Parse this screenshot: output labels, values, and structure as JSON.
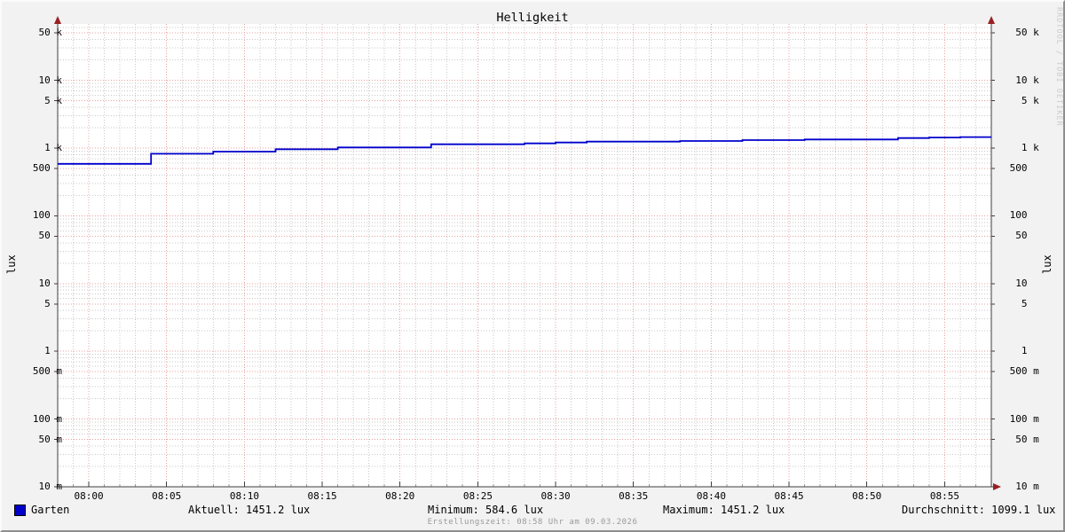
{
  "title": "Helligkeit",
  "watermark": "RRDTOOL / TOBI OETIKER",
  "footer": "Erstellungszeit: 08:58 Uhr am 09.03.2026",
  "axis": {
    "y_label_left": "lux",
    "y_label_right": "lux",
    "y_ticks": [
      {
        "value": 50000,
        "label": "  50 k"
      },
      {
        "value": 10000,
        "label": "  10 k"
      },
      {
        "value": 5000,
        "label": "   5 k"
      },
      {
        "value": 1000,
        "label": "   1 k"
      },
      {
        "value": 500,
        "label": " 500  "
      },
      {
        "value": 100,
        "label": " 100  "
      },
      {
        "value": 50,
        "label": "  50  "
      },
      {
        "value": 10,
        "label": "  10  "
      },
      {
        "value": 5,
        "label": "   5  "
      },
      {
        "value": 1,
        "label": "   1  "
      },
      {
        "value": 0.5,
        "label": " 500 m"
      },
      {
        "value": 0.1,
        "label": " 100 m"
      },
      {
        "value": 0.05,
        "label": "  50 m"
      },
      {
        "value": 0.01,
        "label": "  10 m"
      }
    ],
    "x_ticks": [
      {
        "minute": 2,
        "label": "08:00"
      },
      {
        "minute": 7,
        "label": "08:05"
      },
      {
        "minute": 12,
        "label": "08:10"
      },
      {
        "minute": 17,
        "label": "08:15"
      },
      {
        "minute": 22,
        "label": "08:20"
      },
      {
        "minute": 27,
        "label": "08:25"
      },
      {
        "minute": 32,
        "label": "08:30"
      },
      {
        "minute": 37,
        "label": "08:35"
      },
      {
        "minute": 42,
        "label": "08:40"
      },
      {
        "minute": 47,
        "label": "08:45"
      },
      {
        "minute": 52,
        "label": "08:50"
      },
      {
        "minute": 57,
        "label": "08:55"
      }
    ]
  },
  "legend": {
    "series_label": "Garten",
    "series_color": "#0000cc"
  },
  "stats": {
    "aktuell": {
      "label": "Aktuell:",
      "value": "1451.2 lux"
    },
    "minimum": {
      "label": "Minimum:",
      "value": "584.6 lux"
    },
    "maximum": {
      "label": "Maximum:",
      "value": "1451.2 lux"
    },
    "durchschnitt": {
      "label": "Durchschnitt:",
      "value": "1099.1 lux"
    }
  },
  "colors": {
    "background": "#f2f2f2",
    "canvas": "#ffffff",
    "grid_major": "#e9a0a0",
    "grid_minor": "#c9c9c9",
    "axis": "#3f3f3f",
    "arrow": "#992020",
    "series": "#0000cc",
    "tick_minor": "#9a9a9a"
  },
  "chart_data": {
    "type": "line",
    "line_style": "step",
    "y_scale": "log",
    "title": "Helligkeit",
    "ylabel": "lux",
    "xlabel": "",
    "x_range": [
      "07:58",
      "08:58"
    ],
    "ylim": [
      0.01,
      68000
    ],
    "grid": true,
    "legend_position": "bottom-left",
    "series": [
      {
        "name": "Garten",
        "color": "#0000cc",
        "unit": "lux",
        "steps": [
          {
            "time": "07:58",
            "minute": 0,
            "lux": 584.6
          },
          {
            "time": "08:04",
            "minute": 6,
            "lux": 824
          },
          {
            "time": "08:08",
            "minute": 10,
            "lux": 886
          },
          {
            "time": "08:12",
            "minute": 14,
            "lux": 961
          },
          {
            "time": "08:16",
            "minute": 18,
            "lux": 1022
          },
          {
            "time": "08:22",
            "minute": 24,
            "lux": 1140
          },
          {
            "time": "08:28",
            "minute": 30,
            "lux": 1173
          },
          {
            "time": "08:30",
            "minute": 32,
            "lux": 1209
          },
          {
            "time": "08:32",
            "minute": 34,
            "lux": 1245
          },
          {
            "time": "08:38",
            "minute": 40,
            "lux": 1272
          },
          {
            "time": "08:42",
            "minute": 44,
            "lux": 1310
          },
          {
            "time": "08:46",
            "minute": 48,
            "lux": 1338
          },
          {
            "time": "08:52",
            "minute": 54,
            "lux": 1404
          },
          {
            "time": "08:54",
            "minute": 56,
            "lux": 1431
          },
          {
            "time": "08:56",
            "minute": 58,
            "lux": 1451.2
          }
        ],
        "end_minute": 60,
        "stats": {
          "aktuell": 1451.2,
          "minimum": 584.6,
          "maximum": 1451.2,
          "durchschnitt": 1099.1
        }
      }
    ]
  }
}
